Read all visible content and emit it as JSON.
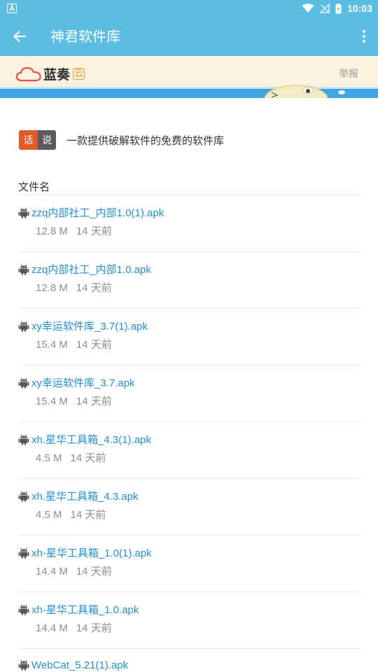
{
  "status_bar": {
    "time": "10:03",
    "icons": [
      "wifi-icon",
      "signal-off-icon",
      "battery-charging-icon"
    ]
  },
  "app_bar": {
    "title": "神君软件库"
  },
  "banner": {
    "brand": "蓝奏",
    "brand_badge": "云",
    "report": "举报"
  },
  "description": {
    "tag_a": "话",
    "tag_b": "说",
    "text": "一款提供破解软件的免费的软件库"
  },
  "file_list": {
    "header": "文件名",
    "items": [
      {
        "name": "zzq内部社工_内部1.0(1).apk",
        "size": "12.8 M",
        "time": "14 天前"
      },
      {
        "name": "zzq内部社工_内部1.0.apk",
        "size": "12.8 M",
        "time": "14 天前"
      },
      {
        "name": "xy幸运软件库_3.7(1).apk",
        "size": "15.4 M",
        "time": "14 天前"
      },
      {
        "name": "xy幸运软件库_3.7.apk",
        "size": "15.4 M",
        "time": "14 天前"
      },
      {
        "name": "xh.星华工具箱_4.3(1).apk",
        "size": "4.5 M",
        "time": "14 天前"
      },
      {
        "name": "xh.星华工具箱_4.3.apk",
        "size": "4.5 M",
        "time": "14 天前"
      },
      {
        "name": "xh-星华工具箱_1.0(1).apk",
        "size": "14.4 M",
        "time": "14 天前"
      },
      {
        "name": "xh-星华工具箱_1.0.apk",
        "size": "14.4 M",
        "time": "14 天前"
      },
      {
        "name": "WebCat_5.21(1).apk",
        "size": "",
        "time": ""
      }
    ]
  },
  "colors": {
    "primary": "#5cbde3",
    "link": "#2390d6",
    "banner_bg": "#fdf1e2",
    "tag_a": "#e25a28",
    "tag_b": "#5b5b5b"
  }
}
